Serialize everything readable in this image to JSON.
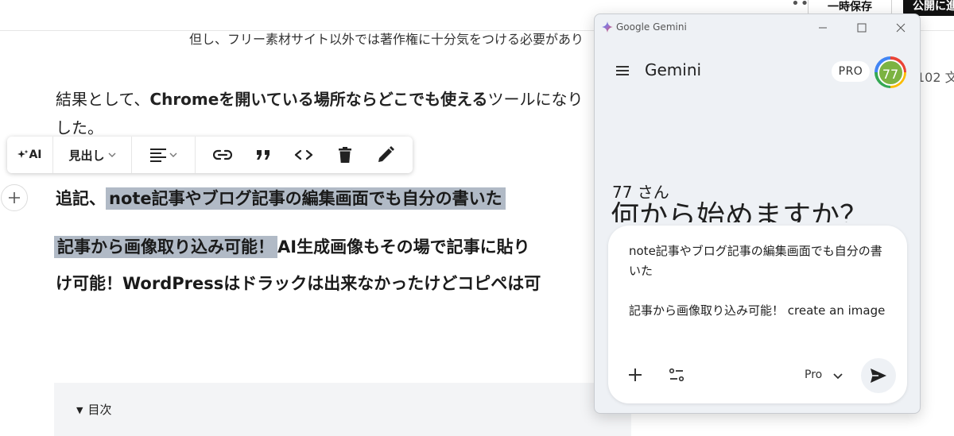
{
  "editor": {
    "top_bar": {
      "more_label": "•••",
      "save_label": "一時保存",
      "publish_label": "公開に進む"
    },
    "note_line": "但し、フリー素材サイト以外では著作権に十分気をつける必要があり",
    "word_count": "102 文",
    "paragraph": {
      "part1": "結果として、",
      "bold": "Chromeを開いている場所ならどこでも使える",
      "part2": "ツールになり",
      "continuation": "した。"
    },
    "toolbar": {
      "ai_label": "AI",
      "heading_label": "見出し"
    },
    "heading": {
      "line1_prefix": "追記、",
      "line1_highlight": "note記事やブログ記事の編集画面でも自分の書いた",
      "line2_highlight": "記事から画像取り込み可能！",
      "line2_rest": "AI生成画像もその場で記事に貼り",
      "line3": "け可能！WordPressはドラックは出来なかったけどコピペは可"
    },
    "toc": {
      "label": "目次"
    }
  },
  "gemini": {
    "window_title": "Google Gemini",
    "app_title": "Gemini",
    "plan_badge": "PRO",
    "avatar_text": "77",
    "greeting": "77 さん",
    "question": "何から始めますか？",
    "prompt": {
      "line1": "note記事やブログ記事の編集画面でも自分の書いた",
      "line2": "記事から画像取り込み可能！ create an image"
    },
    "model_label": "Pro"
  },
  "colors": {
    "highlight": "#b1bac6",
    "publish_bg": "#111111",
    "gemini_bg": "#eef1f5",
    "avatar_fill": "#7cb342"
  }
}
